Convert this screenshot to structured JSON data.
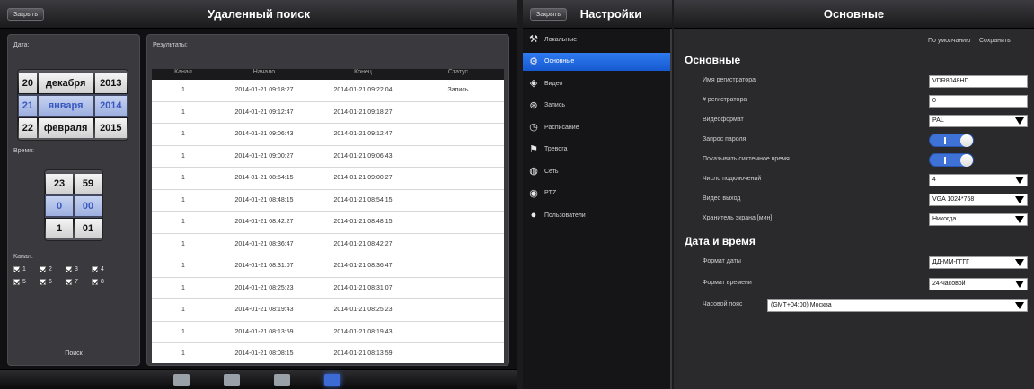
{
  "left": {
    "back_label": "Закрыть",
    "title": "Удаленный поиск",
    "date_label": "Дата:",
    "date_rows": [
      [
        "20",
        "декабря",
        "2013"
      ],
      [
        "21",
        "января",
        "2014"
      ],
      [
        "22",
        "февраля",
        "2015"
      ]
    ],
    "time_label": "Время:",
    "time_rows": [
      [
        "23",
        "59"
      ],
      [
        "0",
        "00"
      ],
      [
        "1",
        "01"
      ]
    ],
    "channel_label": "Канал:",
    "channels": [
      "1",
      "2",
      "3",
      "4",
      "5",
      "6",
      "7",
      "8"
    ],
    "search_label": "Поиск",
    "results_label": "Результаты:",
    "columns": [
      "Канал",
      "Начало",
      "Конец",
      "Статус"
    ],
    "rows": [
      [
        "1",
        "2014-01-21 09:18:27",
        "2014-01-21 09:22:04",
        "Запись"
      ],
      [
        "1",
        "2014-01-21 09:12:47",
        "2014-01-21 09:18:27",
        ""
      ],
      [
        "1",
        "2014-01-21 09:06:43",
        "2014-01-21 09:12:47",
        ""
      ],
      [
        "1",
        "2014-01-21 09:00:27",
        "2014-01-21 09:06:43",
        ""
      ],
      [
        "1",
        "2014-01-21 08:54:15",
        "2014-01-21 09:00:27",
        ""
      ],
      [
        "1",
        "2014-01-21 08:48:15",
        "2014-01-21 08:54:15",
        ""
      ],
      [
        "1",
        "2014-01-21 08:42:27",
        "2014-01-21 08:48:15",
        ""
      ],
      [
        "1",
        "2014-01-21 08:36:47",
        "2014-01-21 08:42:27",
        ""
      ],
      [
        "1",
        "2014-01-21 08:31:07",
        "2014-01-21 08:36:47",
        ""
      ],
      [
        "1",
        "2014-01-21 08:25:23",
        "2014-01-21 08:31:07",
        ""
      ],
      [
        "1",
        "2014-01-21 08:19:43",
        "2014-01-21 08:25:23",
        ""
      ],
      [
        "1",
        "2014-01-21 08:13:59",
        "2014-01-21 08:19:43",
        ""
      ],
      [
        "1",
        "2014-01-21 08:08:15",
        "2014-01-21 08:13:59",
        ""
      ]
    ],
    "tab_icons": [
      "live-view-icon",
      "playback-icon",
      "remote-icon",
      "settings-icon"
    ]
  },
  "right": {
    "back_label": "Закрыть",
    "menu_title": "Настройки",
    "menu_items": [
      {
        "label": "Локальные",
        "icon": "tools-icon"
      },
      {
        "label": "Основные",
        "icon": "gear-icon"
      },
      {
        "label": "Видео",
        "icon": "camera-icon"
      },
      {
        "label": "Запись",
        "icon": "reel-icon"
      },
      {
        "label": "Расписание",
        "icon": "clock-icon"
      },
      {
        "label": "Тревога",
        "icon": "alarm-icon"
      },
      {
        "label": "Сеть",
        "icon": "globe-icon"
      },
      {
        "label": "PTZ",
        "icon": "ptz-icon"
      },
      {
        "label": "Пользователи",
        "icon": "user-icon"
      }
    ],
    "detail_title": "Основные",
    "default_label": "По умолчанию",
    "save_label": "Сохранить",
    "section_basic": "Основные",
    "section_datetime": "Дата и время",
    "basic_fields": [
      {
        "label": "Имя регистратора",
        "value": "VDR8048HD"
      },
      {
        "label": "# регистратора",
        "value": "0"
      },
      {
        "label": "Видеоформат",
        "value": "PAL"
      },
      {
        "label": "Запрос пароля",
        "value": ""
      },
      {
        "label": "Показывать системное время",
        "value": ""
      },
      {
        "label": "Число подключений",
        "value": "4"
      },
      {
        "label": "Видео выход",
        "value": "VGA 1024*768"
      },
      {
        "label": "Хранитель экрана [мин]",
        "value": "Никогда"
      }
    ],
    "datetime_fields": [
      {
        "label": "Формат даты",
        "value": "ДД-ММ-ГГГГ"
      },
      {
        "label": "Формат времени",
        "value": "24-часовой"
      },
      {
        "label": "Часовой пояс",
        "value": "(GMT+04:00) Москва"
      }
    ],
    "accent": "#1e6ae6"
  }
}
